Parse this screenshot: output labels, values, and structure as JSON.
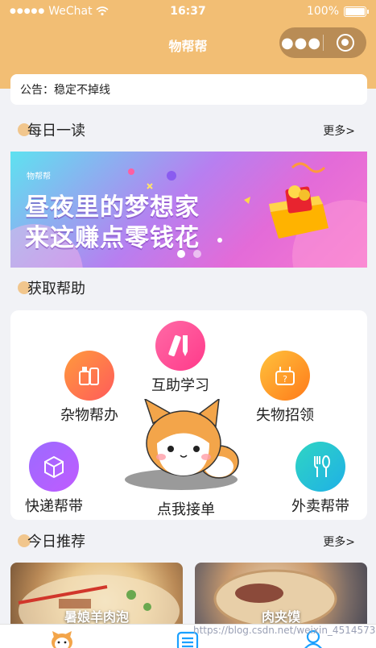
{
  "status_bar": {
    "signal": "●●●●●",
    "carrier": "WeChat",
    "time": "16:37",
    "battery": "100%"
  },
  "nav": {
    "title": "物帮帮",
    "more_icon": "●●●",
    "close_icon": "record-icon"
  },
  "notice": {
    "text": "公告：稳定不掉线"
  },
  "section_daily": {
    "title": "每日一读",
    "more": "更多>"
  },
  "banner": {
    "brand": "物帮帮",
    "line1": "昼夜里的梦想家",
    "line2": "来这赚点零钱花",
    "pages": 2,
    "active_page": 1
  },
  "section_help": {
    "title": "获取帮助"
  },
  "services": [
    {
      "label": "互助学习",
      "icon": "ruler-pencil-icon"
    },
    {
      "label": "杂物帮办",
      "icon": "grocery-icon"
    },
    {
      "label": "失物招领",
      "icon": "question-bag-icon"
    },
    {
      "label": "快递帮带",
      "icon": "package-icon"
    },
    {
      "label": "外卖帮带",
      "icon": "fork-spoon-icon"
    }
  ],
  "accept": {
    "label": "点我接单",
    "icon": "corgi-mascot"
  },
  "section_recommend": {
    "title": "今日推荐",
    "more": "更多>"
  },
  "recommend": [
    {
      "label": "暑娘羊肉泡"
    },
    {
      "label": "肉夹馍"
    }
  ],
  "watermark": "https://blog.csdn.net/weixin_45145739",
  "tabbar": [
    {
      "icon": "corgi-home-icon"
    },
    {
      "icon": "list-icon"
    },
    {
      "icon": "user-icon"
    }
  ],
  "colors": {
    "header": "#f2be74",
    "accent_dot": "#f1c68d",
    "background": "#f1f2f6",
    "tab_icon": "#1aa0ff"
  }
}
